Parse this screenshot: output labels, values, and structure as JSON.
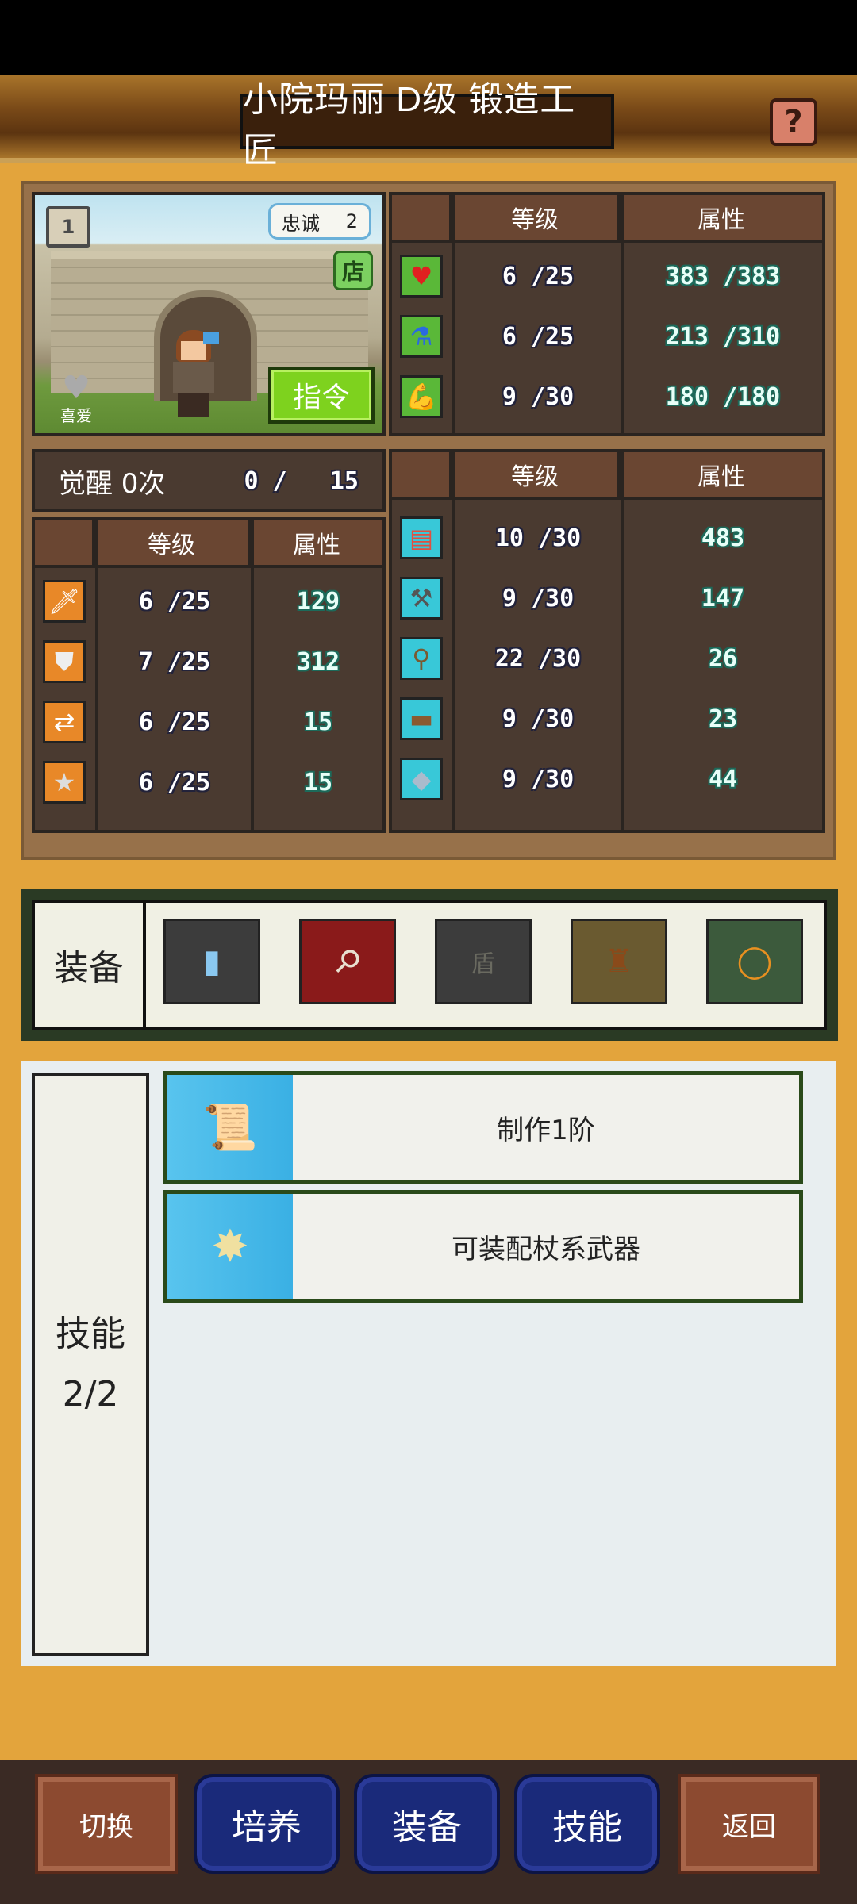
{
  "header": {
    "title": "小院玛丽 D级 锻造工匠",
    "help_symbol": "?"
  },
  "portrait": {
    "loyalty_label": "忠诚",
    "loyalty_value": "2",
    "shop_badge": "店",
    "book_badge": "1",
    "like_label": "喜爱",
    "command_button": "指令"
  },
  "top_stats": {
    "headers": [
      "",
      "等级",
      "属性"
    ],
    "rows": [
      {
        "icon": "heart-icon",
        "level": "6 /25",
        "attr": "383 /383"
      },
      {
        "icon": "potion-icon",
        "level": "6 /25",
        "attr": "213 /310"
      },
      {
        "icon": "muscle-icon",
        "level": "9 /30",
        "attr": "180 /180"
      }
    ]
  },
  "awaken": {
    "label": "觉醒 0次",
    "progress": "0 /   15"
  },
  "combat_stats": {
    "headers": [
      "",
      "等级",
      "属性"
    ],
    "rows": [
      {
        "icon": "sword-icon",
        "level": "6 /25",
        "attr": "129"
      },
      {
        "icon": "shield-icon",
        "level": "7 /25",
        "attr": "312"
      },
      {
        "icon": "arrows-icon",
        "level": "6 /25",
        "attr": "15"
      },
      {
        "icon": "star-icon",
        "level": "6 /25",
        "attr": "15"
      }
    ]
  },
  "craft_stats": {
    "headers": [
      "",
      "等级",
      "属性"
    ],
    "rows": [
      {
        "icon": "book-icon",
        "level": "10 /30",
        "attr": "483"
      },
      {
        "icon": "hammer-icon",
        "level": "9 /30",
        "attr": "147"
      },
      {
        "icon": "shovel-icon",
        "level": "22 /30",
        "attr": "26"
      },
      {
        "icon": "anvil-icon",
        "level": "9 /30",
        "attr": "23"
      },
      {
        "icon": "ore-icon",
        "level": "9 /30",
        "attr": "44"
      }
    ]
  },
  "equipment": {
    "label": "装备",
    "slots": [
      {
        "name": "item-slot-accessory",
        "icon": "bottle-icon",
        "color": "#3c3c3c"
      },
      {
        "name": "item-slot-weapon",
        "icon": "staff-icon",
        "color": "#8a1a1a"
      },
      {
        "name": "item-slot-shield",
        "text": "盾",
        "color": "#3c3c3c"
      },
      {
        "name": "item-slot-armor",
        "icon": "armor-icon",
        "color": "#6a5a30"
      },
      {
        "name": "item-slot-ring",
        "icon": "ring-icon",
        "color": "#3c5a3c"
      }
    ]
  },
  "skills": {
    "label": "技能",
    "count": "2/2",
    "items": [
      {
        "icon": "scroll-icon",
        "text": "制作1阶"
      },
      {
        "icon": "sword-sparkle-icon",
        "text": "可装配杖系武器"
      }
    ]
  },
  "nav": {
    "switch": "切换",
    "train": "培养",
    "equip": "装备",
    "skill": "技能",
    "back": "返回"
  }
}
